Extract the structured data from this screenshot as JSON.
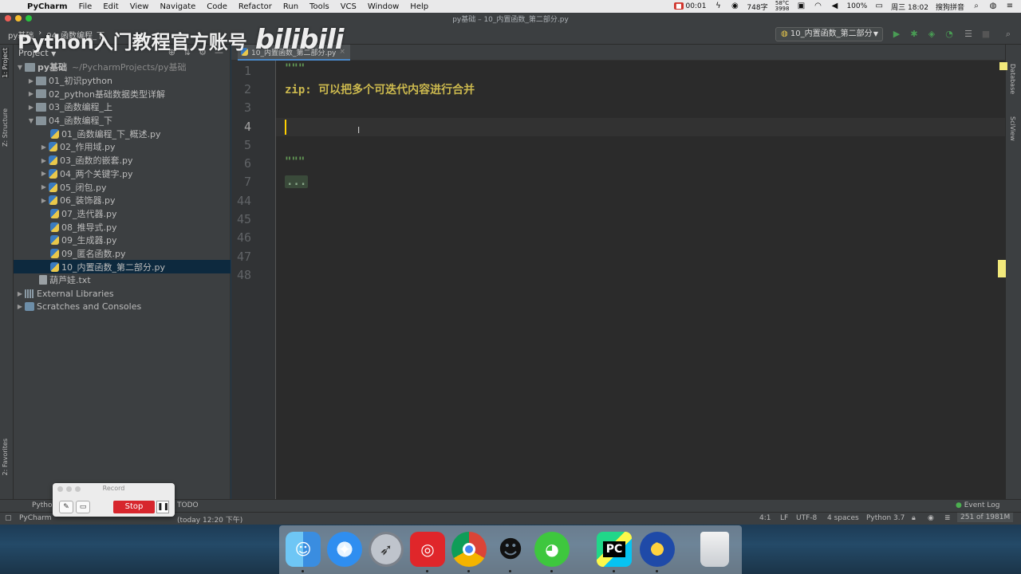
{
  "menubar": {
    "app_name": "PyCharm",
    "menus": [
      "File",
      "Edit",
      "View",
      "Navigate",
      "Code",
      "Refactor",
      "Run",
      "Tools",
      "VCS",
      "Window",
      "Help"
    ],
    "rec_time": "00:01",
    "chars": "748字",
    "temp": "58°C",
    "temp2": "3998",
    "battery": "100%",
    "datetime": "周三 18:02",
    "ime": "搜狗拼音"
  },
  "window": {
    "title": "py基础 – 10_内置函数_第二部分.py"
  },
  "navbar": {
    "breadcrumb_root": "py基础",
    "breadcrumb_folder": "04_函数编程_下",
    "run_config": "10_内置函数_第二部分"
  },
  "watermark": {
    "text": "Python入门教程官方账号",
    "logo": "bilibili"
  },
  "left_strip": {
    "project_tab": "1: Project",
    "structure_tab": "Z: Structure",
    "favorites_tab": "2: Favorites"
  },
  "project": {
    "header": "Project",
    "root_name": "py基础",
    "root_path": "~/PycharmProjects/py基础",
    "folders": [
      "01_初识python",
      "02_python基础数据类型详解",
      "03_函数编程_上",
      "04_函数编程_下"
    ],
    "files": [
      "01_函数编程_下_概述.py",
      "02_作用域.py",
      "03_函数的嵌套.py",
      "04_两个关键字.py",
      "05_闭包.py",
      "06_装饰器.py",
      "07_迭代器.py",
      "08_推导式.py",
      "09_生成器.py",
      "09_匿名函数.py",
      "10_内置函数_第二部分.py"
    ],
    "txt_file": "葫芦娃.txt",
    "external": "External Libraries",
    "scratches": "Scratches and Consoles"
  },
  "editor": {
    "tab_name": "10_内置函数_第二部分.py",
    "line_numbers": [
      "1",
      "2",
      "3",
      "4",
      "5",
      "6",
      "7",
      "44",
      "45",
      "46",
      "47",
      "48"
    ],
    "line1": "\"\"\"",
    "line2": "zip: 可以把多个可迭代内容进行合并",
    "line6": "\"\"\"",
    "line7_fold": "..."
  },
  "right_strip": {
    "database_tab": "Database",
    "sciview_tab": "SciView"
  },
  "bottom_tools": {
    "python_console": "Pytho",
    "todo": "TODO",
    "event_log": "Event Log"
  },
  "status": {
    "message": "PyCharm",
    "message_tail": "(today 12:20 下午)",
    "position": "4:1",
    "line_sep": "LF",
    "encoding": "UTF-8",
    "indent": "4 spaces",
    "interpreter": "Python 3.7",
    "memory": "251 of 1981M"
  },
  "record_widget": {
    "title": "Record",
    "stop_label": "Stop"
  },
  "dock": {
    "icons": [
      "finder-icon",
      "safari-icon",
      "launchpad-icon",
      "netease-music-icon",
      "chrome-icon",
      "qq-icon",
      "wechat-icon",
      "pycharm-icon",
      "reeder-icon",
      "trash-icon"
    ],
    "pycharm_label": "PC"
  },
  "colors": {
    "editor_bg": "#2b2b2b",
    "panel_bg": "#3c3f41",
    "docstring": "#629755",
    "caret": "#ffd000",
    "selection": "#0d293e",
    "stop_red": "#d7262d"
  }
}
